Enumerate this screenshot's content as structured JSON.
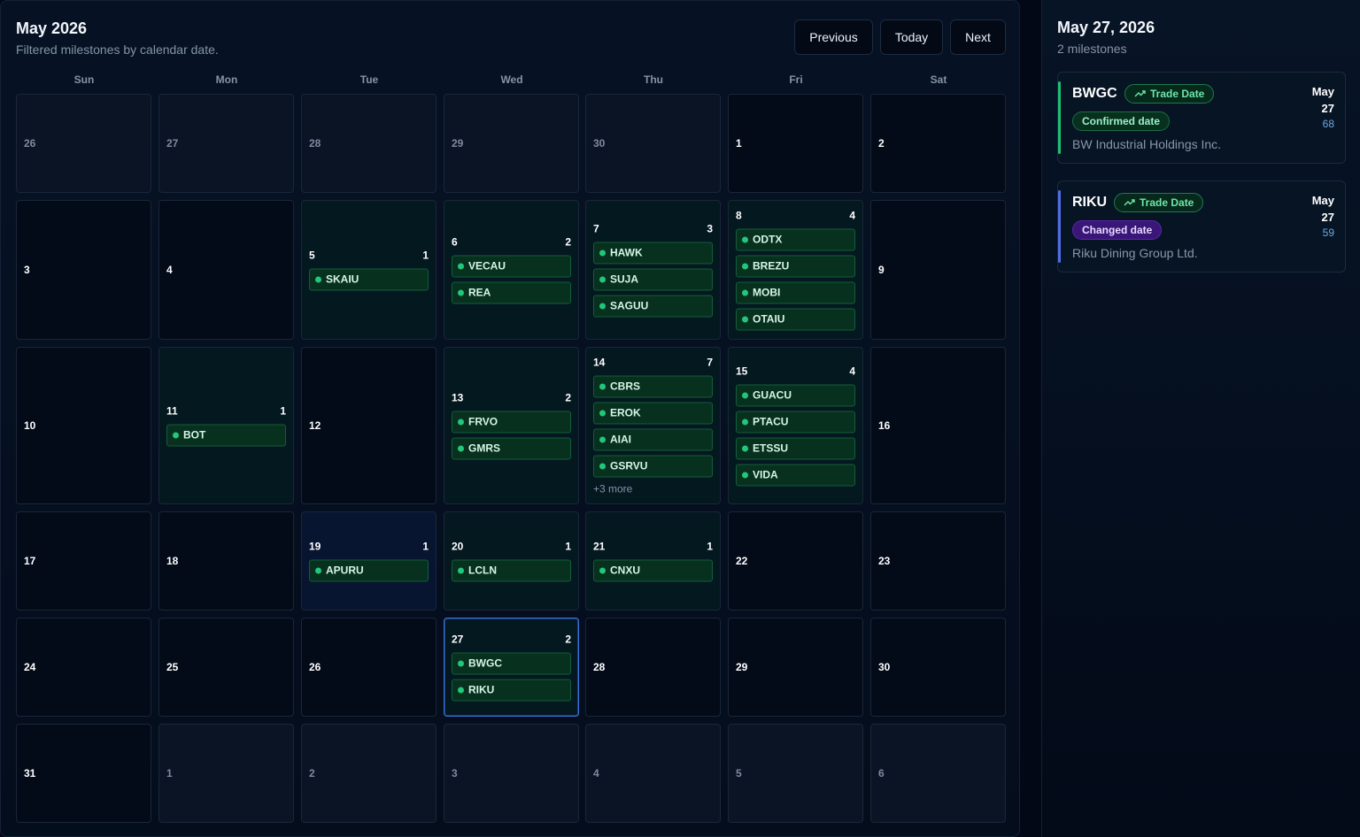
{
  "calendar": {
    "title": "May 2026",
    "subtitle": "Filtered milestones by calendar date.",
    "nav": {
      "previous": "Previous",
      "today": "Today",
      "next": "Next"
    },
    "weekdays": [
      "Sun",
      "Mon",
      "Tue",
      "Wed",
      "Thu",
      "Fri",
      "Sat"
    ],
    "weeks": [
      [
        {
          "day": "26",
          "muted": true
        },
        {
          "day": "27",
          "muted": true
        },
        {
          "day": "28",
          "muted": true
        },
        {
          "day": "29",
          "muted": true
        },
        {
          "day": "30",
          "muted": true
        },
        {
          "day": "1"
        },
        {
          "day": "2"
        }
      ],
      [
        {
          "day": "3"
        },
        {
          "day": "4"
        },
        {
          "day": "5",
          "count": "1",
          "items": [
            "SKAIU"
          ]
        },
        {
          "day": "6",
          "count": "2",
          "items": [
            "VECAU",
            "REA"
          ]
        },
        {
          "day": "7",
          "count": "3",
          "items": [
            "HAWK",
            "SUJA",
            "SAGUU"
          ]
        },
        {
          "day": "8",
          "count": "4",
          "items": [
            "ODTX",
            "BREZU",
            "MOBI",
            "OTAIU"
          ]
        },
        {
          "day": "9"
        }
      ],
      [
        {
          "day": "10"
        },
        {
          "day": "11",
          "count": "1",
          "items": [
            "BOT"
          ]
        },
        {
          "day": "12"
        },
        {
          "day": "13",
          "count": "2",
          "items": [
            "FRVO",
            "GMRS"
          ]
        },
        {
          "day": "14",
          "count": "7",
          "items": [
            "CBRS",
            "EROK",
            "AIAI",
            "GSRVU"
          ],
          "more": "+3 more"
        },
        {
          "day": "15",
          "count": "4",
          "items": [
            "GUACU",
            "PTACU",
            "ETSSU",
            "VIDA"
          ]
        },
        {
          "day": "16"
        }
      ],
      [
        {
          "day": "17"
        },
        {
          "day": "18"
        },
        {
          "day": "19",
          "count": "1",
          "items": [
            "APURU"
          ],
          "highlight": "blue"
        },
        {
          "day": "20",
          "count": "1",
          "items": [
            "LCLN"
          ]
        },
        {
          "day": "21",
          "count": "1",
          "items": [
            "CNXU"
          ]
        },
        {
          "day": "22"
        },
        {
          "day": "23"
        }
      ],
      [
        {
          "day": "24"
        },
        {
          "day": "25"
        },
        {
          "day": "26"
        },
        {
          "day": "27",
          "count": "2",
          "items": [
            "BWGC",
            "RIKU"
          ],
          "selected": true
        },
        {
          "day": "28"
        },
        {
          "day": "29"
        },
        {
          "day": "30"
        }
      ],
      [
        {
          "day": "31"
        },
        {
          "day": "1",
          "muted": true
        },
        {
          "day": "2",
          "muted": true
        },
        {
          "day": "3",
          "muted": true
        },
        {
          "day": "4",
          "muted": true
        },
        {
          "day": "5",
          "muted": true
        },
        {
          "day": "6",
          "muted": true
        }
      ]
    ]
  },
  "detail": {
    "title": "May 27, 2026",
    "subtitle": "2 milestones",
    "milestones": [
      {
        "ticker": "BWGC",
        "type": "Trade Date",
        "type_icon": "trend-up-icon",
        "status": "Confirmed date",
        "status_color": "green",
        "company": "BW Industrial Holdings Inc.",
        "month": "May",
        "day": "27",
        "number": "68",
        "accent": "#1fbf74"
      },
      {
        "ticker": "RIKU",
        "type": "Trade Date",
        "type_icon": "trend-up-icon",
        "status": "Changed date",
        "status_color": "purple",
        "company": "Riku Dining Group Ltd.",
        "month": "May",
        "day": "27",
        "number": "59",
        "accent": "#4f6fe8"
      }
    ]
  }
}
